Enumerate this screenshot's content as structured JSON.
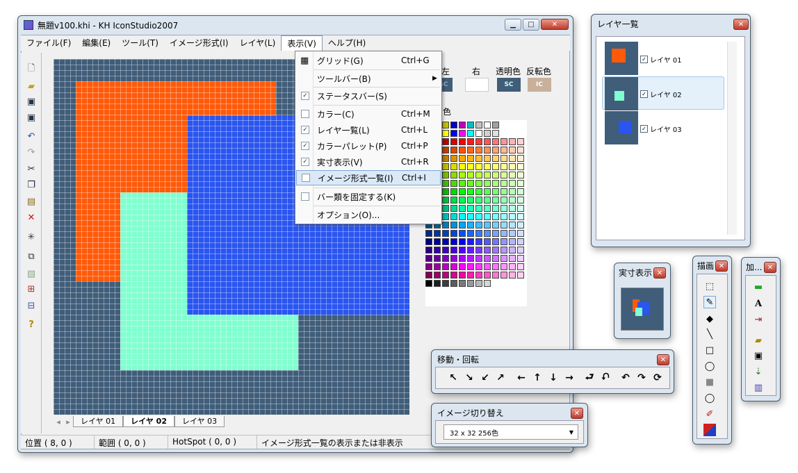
{
  "main": {
    "title": "無題v100.khi - KH IconStudio2007",
    "menu": [
      "ファイル(F)",
      "編集(E)",
      "ツール(T)",
      "イメージ形式(I)",
      "レイヤ(L)",
      "表示(V)",
      "ヘルプ(H)"
    ],
    "tabs": [
      "レイヤ 01",
      "レイヤ 02",
      "レイヤ 03"
    ],
    "status": [
      "位置 ( 8, 0 )",
      "範囲 ( 0, 0 )",
      "HotSpot ( 0, 0 )",
      "イメージ形式一覧の表示または非表示"
    ]
  },
  "view_menu": [
    {
      "label": "グリッド(G)",
      "shortcut": "Ctrl+G",
      "state": "grid"
    },
    {
      "label": "ツールバー(B)",
      "shortcut": "",
      "state": "sub"
    },
    {
      "label": "ステータスバー(S)",
      "shortcut": "",
      "state": "on"
    },
    {
      "label": "カラー(C)",
      "shortcut": "Ctrl+M",
      "state": "off"
    },
    {
      "label": "レイヤ一覧(L)",
      "shortcut": "Ctrl+L",
      "state": "on"
    },
    {
      "label": "カラーパレット(P)",
      "shortcut": "Ctrl+P",
      "state": "on"
    },
    {
      "label": "実寸表示(V)",
      "shortcut": "Ctrl+R",
      "state": "on"
    },
    {
      "label": "イメージ形式一覧(I)",
      "shortcut": "Ctrl+I",
      "state": "off"
    },
    {
      "label": "バー類を固定する(K)",
      "shortcut": "",
      "state": "off"
    },
    {
      "label": "オプション(O)...",
      "shortcut": "",
      "state": "none"
    }
  ],
  "color_panel": {
    "left": "左",
    "right": "右",
    "transparent": "透明色",
    "inverse": "反転色",
    "sc": "SC",
    "ic": "IC",
    "palette_label": "色"
  },
  "layer_window": {
    "title": "レイヤ一覧",
    "layers": [
      "レイヤ 01",
      "レイヤ 02",
      "レイヤ 03"
    ]
  },
  "actual_size": {
    "title": "実寸表示"
  },
  "draw": {
    "title": "描画"
  },
  "add": {
    "title": "加..."
  },
  "move": {
    "title": "移動・回転"
  },
  "image_switch": {
    "title": "イメージ切り替え",
    "value": "32 x 32 256色"
  },
  "colors": {
    "orange": "#ff5a0a",
    "blue": "#2a55f0",
    "mint": "#80ffd0",
    "bg": "#405d7a"
  }
}
